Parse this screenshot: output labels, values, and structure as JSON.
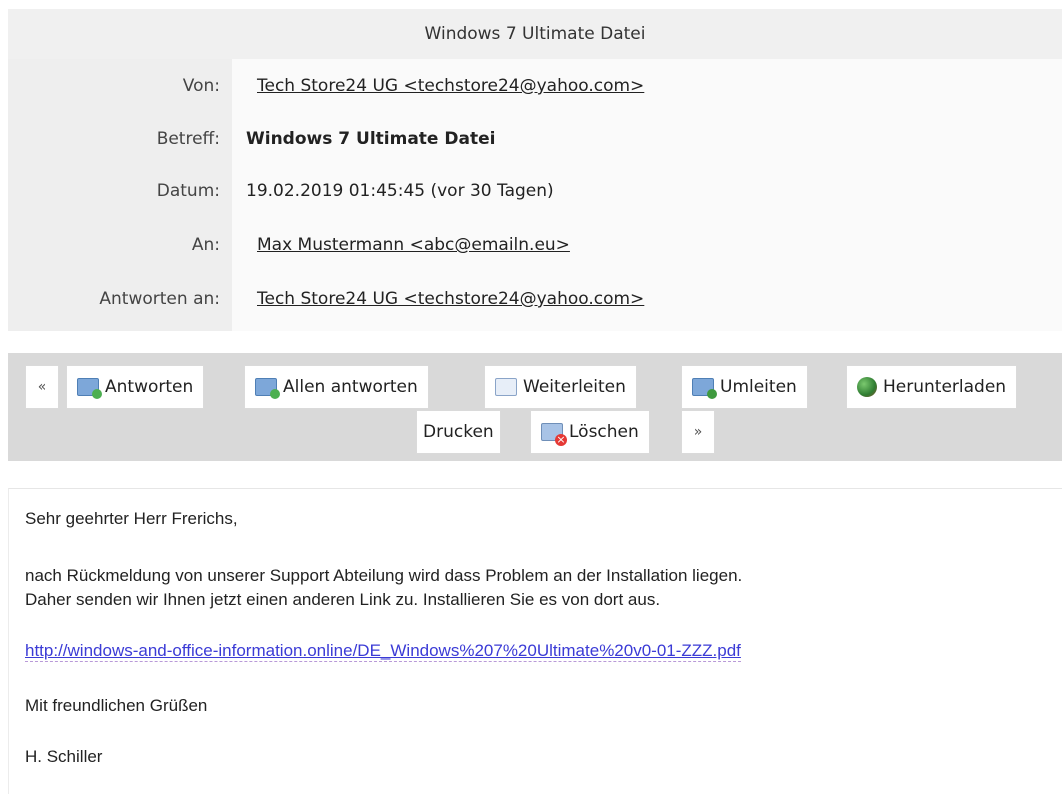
{
  "title": "Windows 7 Ultimate Datei",
  "header": {
    "von_label": "Von:",
    "von_value": "Tech Store24 UG <techstore24@yahoo.com>",
    "betreff_label": "Betreff:",
    "betreff_value": "Windows 7 Ultimate Datei",
    "datum_label": "Datum:",
    "datum_value": "19.02.2019 01:45:45 (vor 30 Tagen)",
    "an_label": "An:",
    "an_value": "Max Mustermann <abc@emailn.eu>",
    "reply_label": "Antworten an:",
    "reply_value": "Tech Store24 UG <techstore24@yahoo.com>"
  },
  "toolbar": {
    "prev": "«",
    "antworten": "Antworten",
    "allen_antworten": "Allen antworten",
    "weiterleiten": "Weiterleiten",
    "umleiten": "Umleiten",
    "herunterladen": "Herunterladen",
    "drucken": "Drucken",
    "loeschen": "Löschen",
    "next": "»"
  },
  "body": {
    "greeting": "Sehr geehrter Herr Frerichs,",
    "line1": "nach Rückmeldung von unserer Support Abteilung wird dass Problem an der Installation liegen.",
    "line2": "Daher senden wir Ihnen jetzt einen anderen Link zu. Installieren Sie es von dort aus.",
    "link": "http://windows-and-office-information.online/DE_Windows%207%20Ultimate%20v0-01-ZZZ.pdf",
    "closing": "Mit freundlichen Grüßen",
    "signature": "H. Schiller"
  },
  "icons": {
    "antworten": "reply-icon",
    "allen_antworten": "reply-all-icon",
    "weiterleiten": "forward-icon",
    "umleiten": "redirect-icon",
    "herunterladen": "download-globe-icon",
    "loeschen": "delete-icon"
  },
  "colors": {
    "link": "#3b3bd6",
    "toolbar_bg": "#d9d9d9",
    "label_bg": "#eeeeee"
  }
}
